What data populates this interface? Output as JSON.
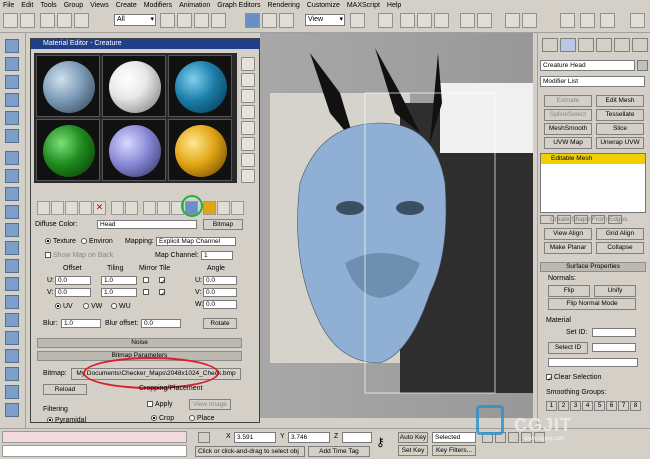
{
  "menu": [
    "File",
    "Edit",
    "Tools",
    "Group",
    "Views",
    "Create",
    "Modifiers",
    "Animation",
    "Graph Editors",
    "Rendering",
    "Customize",
    "MAXScript",
    "Help"
  ],
  "toolbar": {
    "selection_filter": "All",
    "ref_coord": "View"
  },
  "material_editor": {
    "title": "Material Editor - Creature",
    "slot_colors": [
      "#7d9bb8",
      "#e8e8e8",
      "#1c7ea8",
      "#1f8a1e",
      "#8989d6",
      "#e1a514"
    ],
    "diffuse_label": "Diffuse Color:",
    "map_name": "Head",
    "map_type": "Bitmap",
    "coords": {
      "texture": "Texture",
      "environ": "Environ",
      "mapping_label": "Mapping:",
      "mapping_value": "Explicit Map Channel",
      "show_map_on_back": "Show Map on Back",
      "map_channel_label": "Map Channel:",
      "map_channel_value": "1"
    },
    "headers": {
      "offset": "Offset",
      "tiling": "Tiling",
      "mirror_tile": "Mirror Tile",
      "angle": "Angle"
    },
    "u": {
      "label": "U:",
      "offset": "0.0",
      "tiling": "1.0",
      "angle_label": "U:",
      "angle": "0.0"
    },
    "v": {
      "label": "V:",
      "offset": "0.0",
      "tiling": "1.0",
      "angle_label": "V:",
      "angle": "0.0"
    },
    "w": {
      "angle_label": "W:",
      "angle": "0.0"
    },
    "uvw": {
      "uv": "UV",
      "vw": "VW",
      "wu": "WU"
    },
    "blur_label": "Blur:",
    "blur": "1.0",
    "blur_offset_label": "Blur offset:",
    "blur_offset": "0.0",
    "rotate": "Rotate",
    "noise": "Noise",
    "bitmap_params": "Bitmap Parameters",
    "bitmap_label": "Bitmap:",
    "bitmap_path": "My Documents\\Checker_Maps\\2048x1024_Check.bmp",
    "reload": "Reload",
    "cropping": "Cropping/Placement",
    "apply": "Apply",
    "view_image": "View Image",
    "filtering": "Filtering",
    "pyramidal": "Pyramidal",
    "crop": "Crop",
    "place": "Place"
  },
  "command_panel": {
    "object_name": "Creature Head",
    "modifier_list": "Modifier List",
    "buttons": [
      "Extrude",
      "Edit Mesh",
      "SplineSelect",
      "Tessellate",
      "MeshSmooth",
      "Slice",
      "UVW Map",
      "Unwrap UVW"
    ],
    "stack_item": "Editable Mesh",
    "align_header": "Create Shape From Edges",
    "align_buttons": [
      "View Align",
      "Grid Align",
      "Make Planar",
      "Collapse"
    ],
    "surface_props": "Surface Properties",
    "normals": "Normals:",
    "flip": "Flip",
    "unify": "Unify",
    "flip_normal_mode": "Flip Normal Mode",
    "material": "Material",
    "set_id": "Set ID:",
    "select_id": "Select ID",
    "clear_selection": "Clear Selection",
    "smoothing_groups": "Smoothing Groups:",
    "smoothing_numbers": [
      "1",
      "2",
      "3",
      "4",
      "5",
      "6",
      "7",
      "8"
    ]
  },
  "status": {
    "x_label": "X",
    "x": "3.591",
    "y_label": "Y",
    "y": "3.746",
    "z_label": "Z",
    "prompt": "Click or click-and-drag to select obj",
    "add_time_tag": "Add Time Tag",
    "auto_key": "Auto Key",
    "set_key": "Set Key",
    "selected": "Selected",
    "key_filters": "Key Filters..."
  },
  "watermark": {
    "text": "CGJIT",
    "sub": "www.cgjoy.com"
  }
}
